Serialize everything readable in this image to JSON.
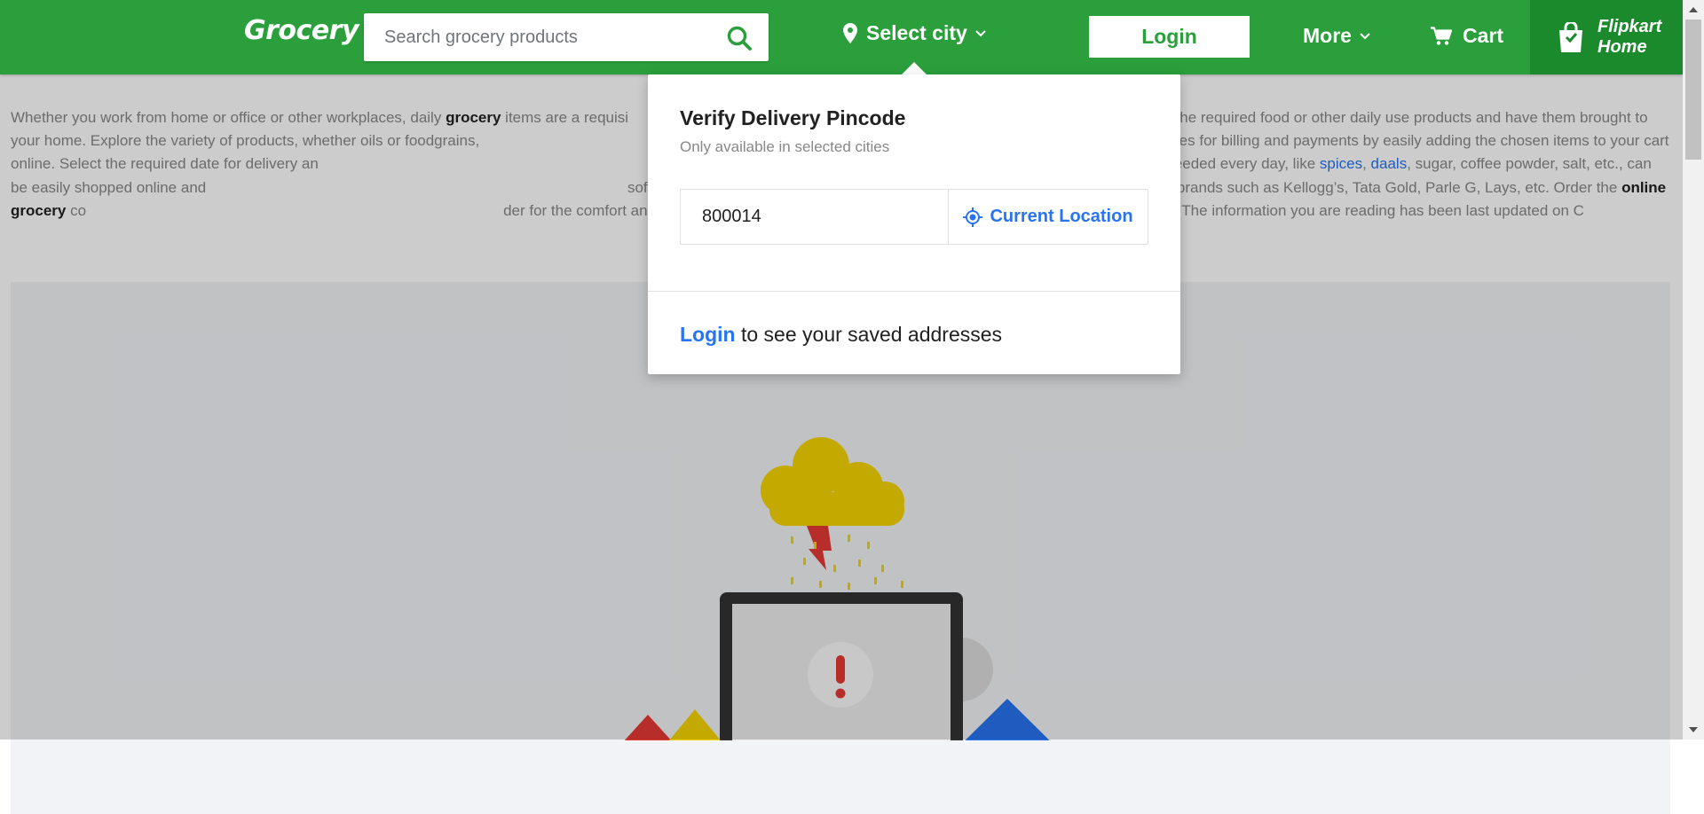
{
  "header": {
    "logo": "Grocery",
    "search_placeholder": "Search grocery products",
    "city_label": "Select city",
    "login_label": "Login",
    "more_label": "More",
    "cart_label": "Cart",
    "flipkart_home_line1": "Flipkart",
    "flipkart_home_line2": "Home",
    "brand_color": "#2a9f3b"
  },
  "description": {
    "p1": "Whether you work from home or office or other workplaces, daily ",
    "b1": "grocery",
    "p2": " items are a requisi",
    "p3": "n easily browse for the required food or other daily use products and have them brought to your home. Explore the variety of products, whether oils or foodgrains, ",
    "p4": "e otherwise lost in waiting in lengthy queues for billing and payments by easily adding the chosen items to your cart online. Select the required date for delivery an",
    "p5": "henever you need them and in the available quantity. Essentials needed every day, like ",
    "link1": "spices",
    "sep": ", ",
    "link2": "daals",
    "p6": ", sugar, coffee powder, salt, etc., can be easily shopped online and",
    "p7": " softeners, toothpaste, etc., can also be bought online. Buy grocery and more from brands such as Kellogg’s, Tata Gold, Parle G, Lays, etc. Order the ",
    "b2": "online grocery",
    "p8": " co",
    "p9": "der for the comfort and convenience of your loved ones who cannot move out of the house and shop. The information you are reading has been last updated on C"
  },
  "popup": {
    "title": "Verify Delivery Pincode",
    "subtitle": "Only available in selected cities",
    "pincode_value": "800014",
    "current_location_label": "Current Location",
    "login_link": "Login",
    "footer_text": " to see your saved addresses"
  },
  "icons": {
    "search": "search-icon",
    "location": "location-pin-icon",
    "chevron": "chevron-down-icon",
    "cart": "cart-icon",
    "flipkart": "flipkart-bag-icon",
    "gps": "gps-target-icon"
  }
}
